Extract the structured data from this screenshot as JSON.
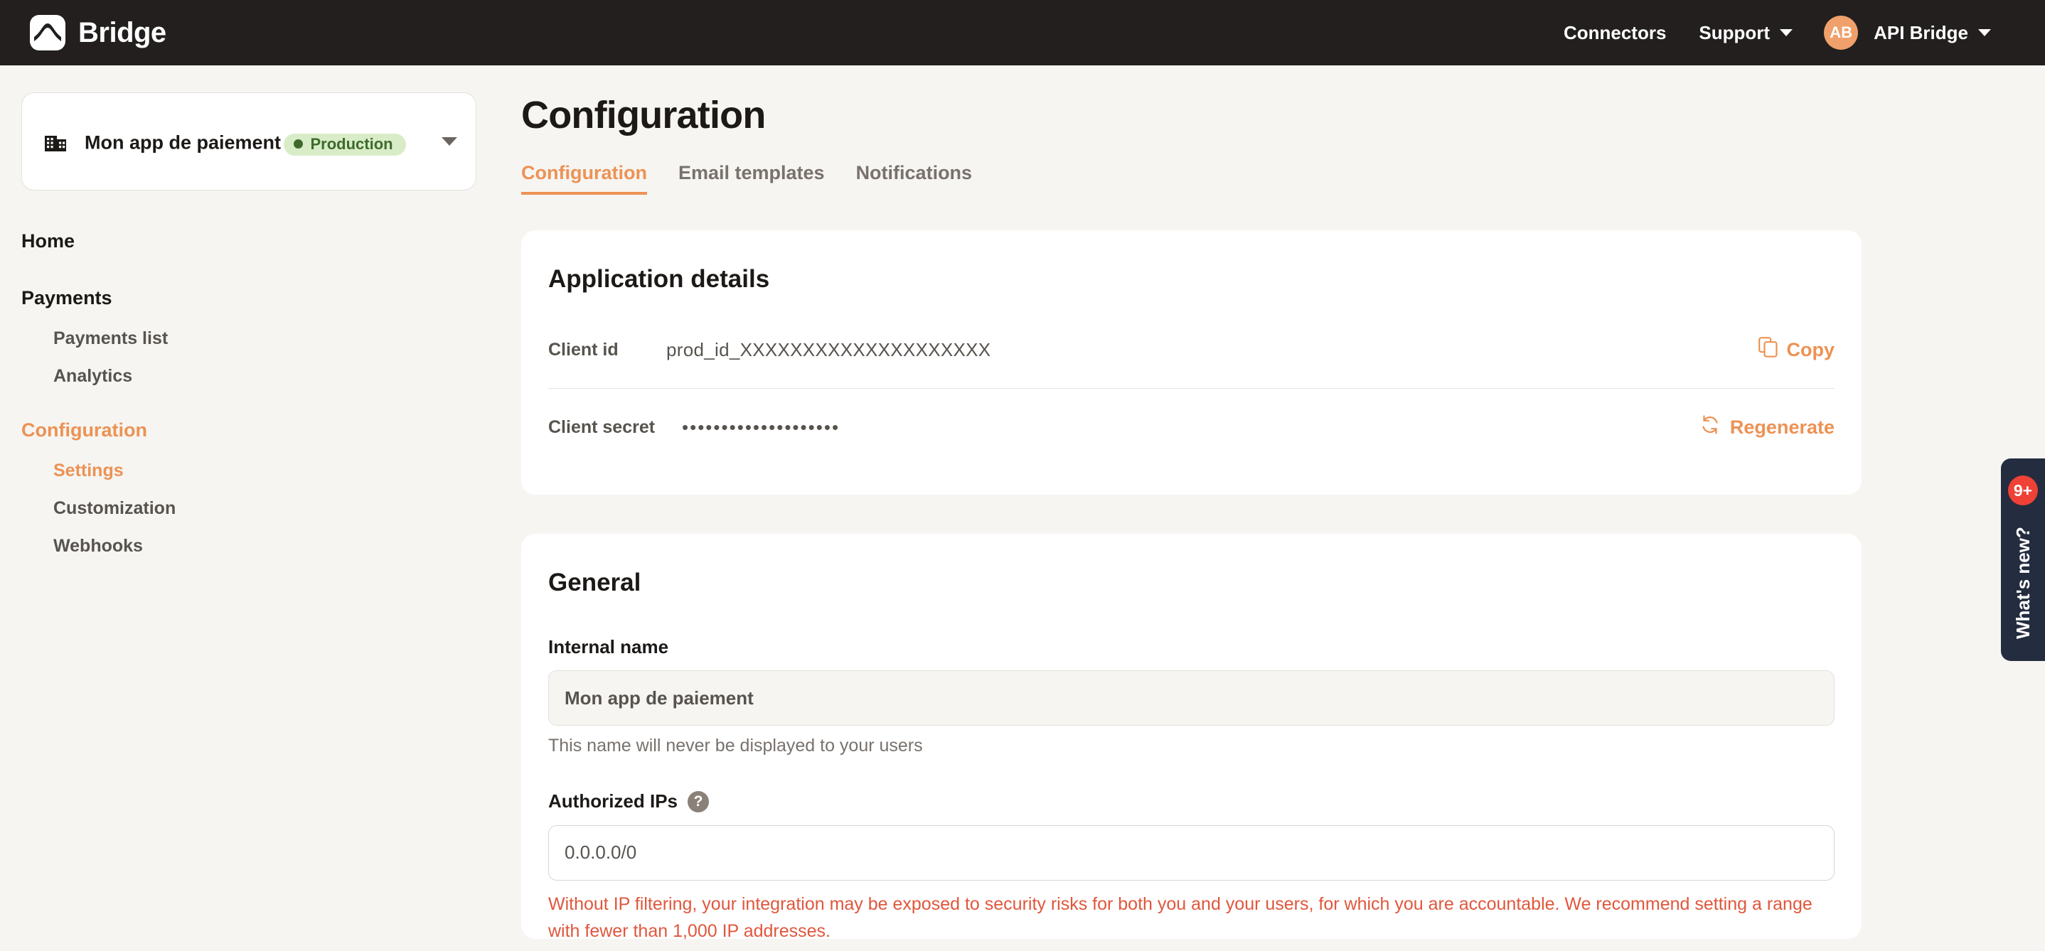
{
  "brand": {
    "name": "Bridge",
    "logo_icon": "bridge-arch-icon"
  },
  "topnav": {
    "connectors_label": "Connectors",
    "support_label": "Support",
    "account_initials": "AB",
    "account_name": "API Bridge"
  },
  "sidebar": {
    "app_selector": {
      "icon": "building-icon",
      "app_name": "Mon app de paiement",
      "environment": "Production",
      "environment_color": "#3e6b2c",
      "environment_bg": "#d9ecc8"
    },
    "items": [
      {
        "label": "Home",
        "level": "top",
        "active": false
      },
      {
        "label": "Payments",
        "level": "top",
        "active": false
      },
      {
        "label": "Payments list",
        "level": "sub",
        "active": false
      },
      {
        "label": "Analytics",
        "level": "sub",
        "active": false
      },
      {
        "label": "Configuration",
        "level": "top",
        "active": true
      },
      {
        "label": "Settings",
        "level": "sub",
        "active": true
      },
      {
        "label": "Customization",
        "level": "sub",
        "active": false
      },
      {
        "label": "Webhooks",
        "level": "sub",
        "active": false
      }
    ]
  },
  "main": {
    "page_title": "Configuration",
    "tabs": [
      {
        "label": "Configuration",
        "active": true
      },
      {
        "label": "Email templates",
        "active": false
      },
      {
        "label": "Notifications",
        "active": false
      }
    ],
    "application_details": {
      "heading": "Application details",
      "client_id_label": "Client id",
      "client_id_value": "prod_id_XXXXXXXXXXXXXXXXXXXX",
      "copy_label": "Copy",
      "copy_icon": "copy-icon",
      "client_secret_label": "Client secret",
      "client_secret_value": "••••••••••••••••••••",
      "regenerate_label": "Regenerate",
      "regenerate_icon": "refresh-icon"
    },
    "general": {
      "heading": "General",
      "internal_name_label": "Internal name",
      "internal_name_value": "Mon app de paiement",
      "internal_name_helper": "This name will never be displayed to your users",
      "authorized_ips_label": "Authorized IPs",
      "authorized_ips_help_icon": "help-icon",
      "authorized_ips_value": "0.0.0.0/0",
      "authorized_ips_warning": "Without IP filtering, your integration may be exposed to security risks for both you and your users, for which you are accountable. We recommend setting a range with fewer than 1,000 IP addresses."
    }
  },
  "whats_new": {
    "badge_count": "9+",
    "label": "What's new?",
    "badge_color": "#ef4136",
    "panel_color": "#242c3f"
  },
  "theme": {
    "accent": "#ec9254",
    "danger": "#e0573c",
    "page_bg": "#f6f5f2",
    "nav_bg": "#221f1e"
  }
}
